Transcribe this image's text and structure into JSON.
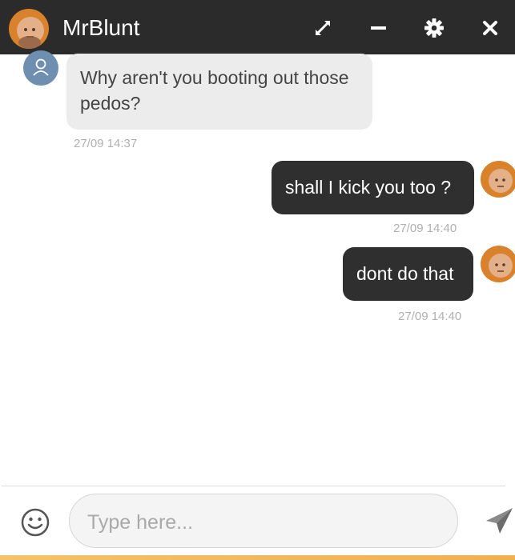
{
  "header": {
    "title": "MrBlunt",
    "icons": [
      "expand-icon",
      "minimize-icon",
      "gear-icon",
      "close-icon"
    ],
    "background": "#2b2b2b"
  },
  "messages": [
    {
      "direction": "incoming",
      "text": "Why aren't you booting out those pedos?",
      "time": "27/09 14:37"
    },
    {
      "direction": "outgoing",
      "text": "shall I kick you too ?",
      "time": "27/09 14:40"
    },
    {
      "direction": "outgoing",
      "text": "dont do that",
      "time": "27/09 14:40"
    }
  ],
  "composer": {
    "placeholder": "Type here...",
    "value": "",
    "emoji_icon": "smiley-icon",
    "send_icon": "send-icon"
  },
  "colors": {
    "outgoing_bubble": "#2f2f2f",
    "incoming_bubble": "#ececec",
    "accent_bar": "#f5c16a"
  }
}
